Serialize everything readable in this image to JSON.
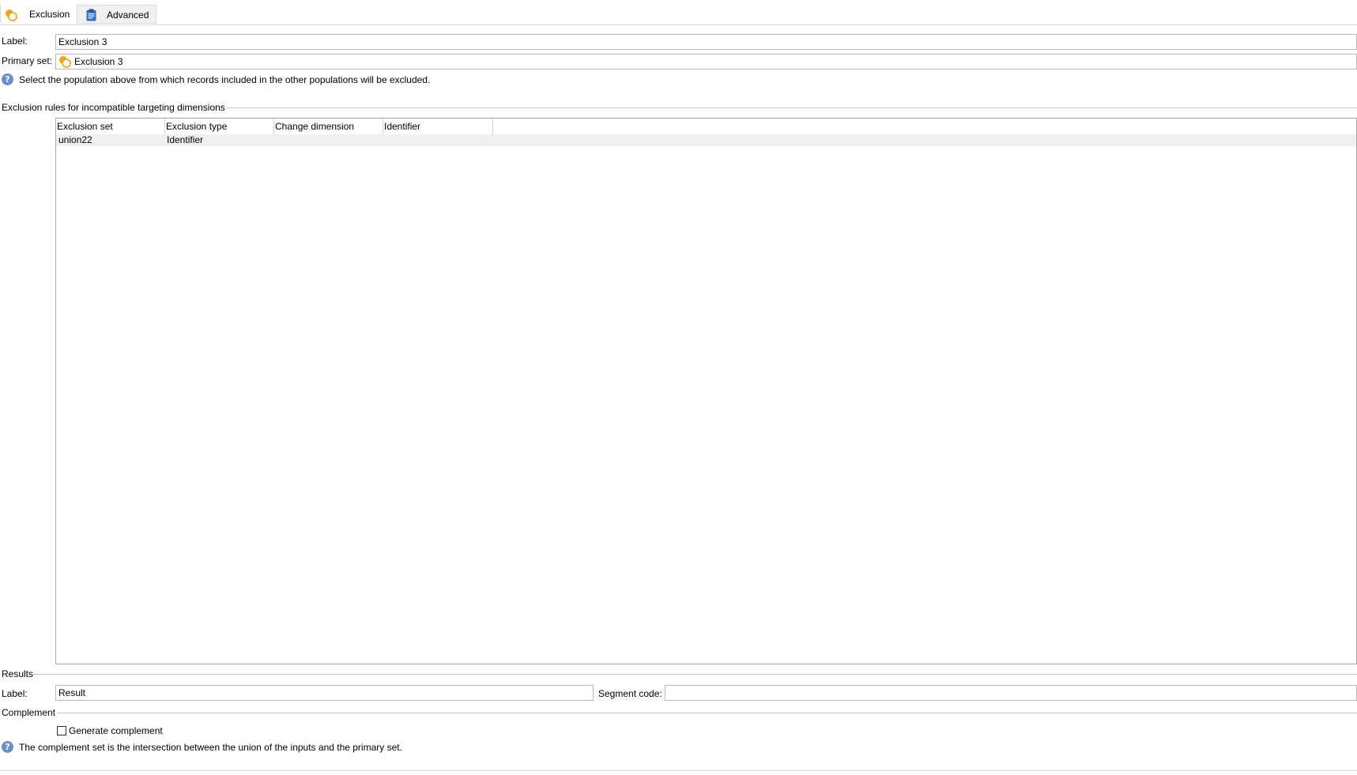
{
  "tabs": [
    {
      "label": "Exclusion",
      "icon": "exclusion-icon",
      "active": true
    },
    {
      "label": "Advanced",
      "icon": "clipboard-icon",
      "active": false
    }
  ],
  "general": {
    "label_caption": "Label:",
    "label_value": "Exclusion 3",
    "primary_set_caption": "Primary set:",
    "primary_set_value": "Exclusion 3",
    "primary_help": "Select the population above from which records included in the other populations will be excluded."
  },
  "rules": {
    "title": "Exclusion rules for incompatible targeting dimensions",
    "columns": [
      "Exclusion set",
      "Exclusion type",
      "Change dimension",
      "Identifier"
    ],
    "rows": [
      [
        "union22",
        "Identifier",
        "",
        ""
      ]
    ]
  },
  "results": {
    "title": "Results",
    "label_caption": "Label:",
    "label_value": "Result",
    "segment_caption": "Segment code:",
    "segment_value": ""
  },
  "complement": {
    "title": "Complement",
    "checkbox_label": "Generate complement",
    "checked": false,
    "help": "The complement set is the intersection between the union of the inputs and the primary set."
  },
  "colors": {
    "accent_orange": "#f0a21c",
    "info_blue": "#6b8fc9",
    "clipboard_blue": "#2f6fc4"
  }
}
